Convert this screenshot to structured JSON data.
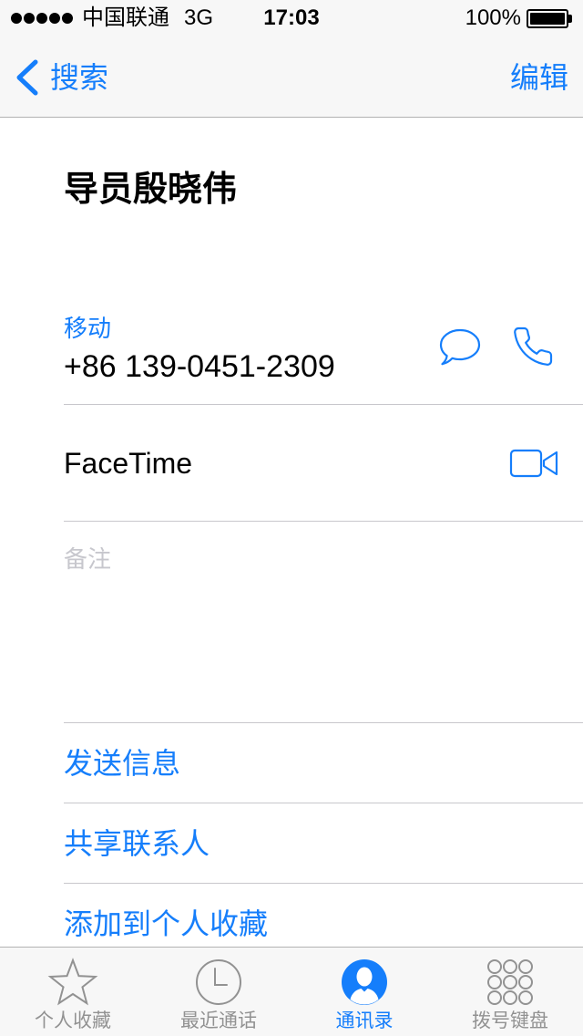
{
  "status_bar": {
    "signal_bars": 5,
    "carrier": "中国联通",
    "network": "3G",
    "time": "17:03",
    "battery_text": "100%",
    "battery_level": 1.0
  },
  "nav": {
    "back_label": "搜索",
    "back_icon": "chevron-left-icon",
    "edit_label": "编辑"
  },
  "contact": {
    "name": "导员殷晓伟",
    "phone": {
      "label": "移动",
      "number": "+86 139-0451-2309",
      "icons": [
        "message-icon",
        "phone-icon"
      ]
    },
    "facetime": {
      "label": "FaceTime",
      "icon": "video-icon"
    },
    "notes": {
      "placeholder": "备注"
    }
  },
  "actions": [
    {
      "label": "发送信息"
    },
    {
      "label": "共享联系人"
    },
    {
      "label": "添加到个人收藏"
    }
  ],
  "tabbar": {
    "tabs": [
      {
        "label": "个人收藏",
        "icon": "star-icon",
        "active": false
      },
      {
        "label": "最近通话",
        "icon": "clock-icon",
        "active": false
      },
      {
        "label": "通讯录",
        "icon": "contacts-icon",
        "active": true
      },
      {
        "label": "拨号键盘",
        "icon": "keypad-icon",
        "active": false
      }
    ]
  },
  "colors": {
    "accent": "#157efb",
    "inactive": "#929292",
    "divider": "#c8c7cc",
    "placeholder": "#c7c7cd",
    "bar_background": "#f7f7f7",
    "bar_border": "#b2b2b2"
  }
}
